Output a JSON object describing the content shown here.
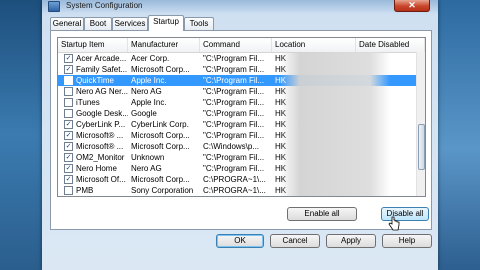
{
  "window": {
    "title": "System Configuration",
    "close_glyph": "✕"
  },
  "tabs": [
    {
      "label": "General"
    },
    {
      "label": "Boot"
    },
    {
      "label": "Services"
    },
    {
      "label": "Startup",
      "active": true
    },
    {
      "label": "Tools"
    }
  ],
  "table": {
    "columns": [
      "Startup Item",
      "Manufacturer",
      "Command",
      "Location",
      "Date Disabled"
    ],
    "rows": [
      {
        "checked": true,
        "item": "Acer Arcade...",
        "manufacturer": "Acer Corp.",
        "command": "\"C:\\Program Fil...",
        "location": "HK"
      },
      {
        "checked": true,
        "item": "Family Safet...",
        "manufacturer": "Microsoft Corp...",
        "command": "\"C:\\Program Fil...",
        "location": "HK"
      },
      {
        "checked": false,
        "item": "QuickTime",
        "manufacturer": "Apple Inc.",
        "command": "\"C:\\Program Fil...",
        "location": "HK",
        "selected": true
      },
      {
        "checked": false,
        "item": "Nero AG Ner...",
        "manufacturer": "Nero AG",
        "command": "\"C:\\Program Fil...",
        "location": "HK"
      },
      {
        "checked": false,
        "item": "iTunes",
        "manufacturer": "Apple Inc.",
        "command": "\"C:\\Program Fil...",
        "location": "HK"
      },
      {
        "checked": false,
        "item": "Google Desk...",
        "manufacturer": "Google",
        "command": "\"C:\\Program Fil...",
        "location": "HK"
      },
      {
        "checked": true,
        "item": "CyberLink P...",
        "manufacturer": "CyberLink Corp.",
        "command": "\"C:\\Program Fil...",
        "location": "HK"
      },
      {
        "checked": true,
        "item": "Microsoft® ...",
        "manufacturer": "Microsoft Corp...",
        "command": "\"C:\\Program Fil...",
        "location": "HK"
      },
      {
        "checked": true,
        "item": "Microsoft® ...",
        "manufacturer": "Microsoft Corp...",
        "command": "C:\\Windows\\p...",
        "location": "HK"
      },
      {
        "checked": true,
        "item": "OM2_Monitor",
        "manufacturer": "Unknown",
        "command": "\"C:\\Program Fil...",
        "location": "HK"
      },
      {
        "checked": true,
        "item": "Nero Home",
        "manufacturer": "Nero AG",
        "command": "\"C:\\Program Fil...",
        "location": "HK"
      },
      {
        "checked": true,
        "item": "Microsoft Of...",
        "manufacturer": "Microsoft Corp...",
        "command": "C:\\PROGRA~1\\...",
        "location": "HK"
      },
      {
        "checked": false,
        "item": "PMB",
        "manufacturer": "Sony Corporation",
        "command": "C:\\PROGRA~1\\...",
        "location": "HK"
      }
    ]
  },
  "buttons": {
    "enable_all": "Enable all",
    "disable_all": "Disable all",
    "ok": "OK",
    "cancel": "Cancel",
    "apply": "Apply",
    "help": "Help"
  }
}
